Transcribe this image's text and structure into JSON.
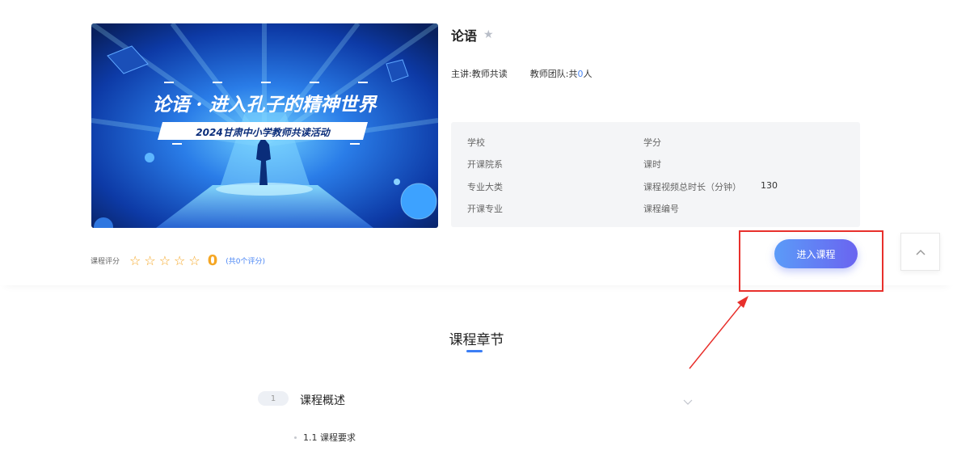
{
  "course": {
    "title": "论语",
    "banner_title": "论语 · 进入孔子的精神世界",
    "banner_subtitle": "2024甘肃中小学教师共读活动",
    "lecturer_label": "主讲:",
    "lecturer": "教师共读",
    "team_label": "教师团队:",
    "team_prefix": "共",
    "team_count": "0",
    "team_suffix": "人"
  },
  "info": {
    "school_label": "学校",
    "school_value": "",
    "dept_label": "开课院系",
    "dept_value": "",
    "category_label": "专业大类",
    "category_value": "",
    "major_label": "开课专业",
    "major_value": "",
    "credit_label": "学分",
    "credit_value": "",
    "hours_label": "课时",
    "hours_value": "",
    "video_label": "课程视频总时长（分钟）",
    "video_value": "130",
    "code_label": "课程编号",
    "code_value": ""
  },
  "rating": {
    "label": "课程评分",
    "score": "0",
    "count_text": "(共0个评分)",
    "star_glyph": "☆"
  },
  "actions": {
    "enter_label": "进入课程"
  },
  "chapters": {
    "section_title": "课程章节",
    "items": [
      {
        "num": "1",
        "name": "课程概述",
        "lessons": [
          {
            "label": "1.1 课程要求"
          }
        ]
      }
    ]
  },
  "colors": {
    "accent": "#4a86f5",
    "star": "#f5a623",
    "annotation": "#e8302c"
  }
}
